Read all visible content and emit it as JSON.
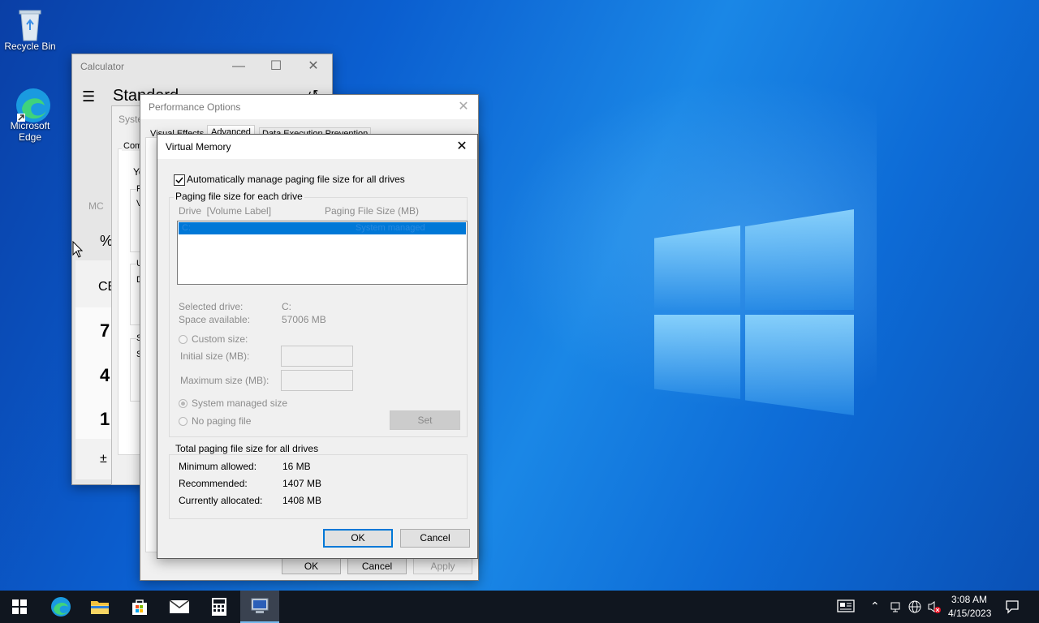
{
  "desktop": {
    "icons": [
      {
        "label": "Recycle Bin",
        "icon": "recycle-bin-icon"
      },
      {
        "label": "Microsoft Edge",
        "icon": "edge-icon"
      }
    ]
  },
  "calculator": {
    "title": "Calculator",
    "mode": "Standard",
    "buttons": [
      "MC",
      "%",
      "CE",
      "7",
      "4",
      "1",
      "±"
    ]
  },
  "system_properties": {
    "title_partial": "Syste",
    "tab_partial": "Com",
    "text_fragments": [
      "Yo",
      "P",
      "V",
      "U",
      "D",
      "S",
      "S"
    ]
  },
  "performance_options": {
    "title": "Performance Options",
    "tabs": [
      "Visual Effects",
      "Advanced",
      "Data Execution Prevention"
    ],
    "active_tab": "Advanced",
    "buttons": {
      "ok": "OK",
      "cancel": "Cancel",
      "apply": "Apply"
    }
  },
  "virtual_memory": {
    "title": "Virtual Memory",
    "auto_manage_label": "Automatically manage paging file size for all drives",
    "auto_manage_checked": true,
    "per_drive_group": "Paging file size for each drive",
    "columns": {
      "drive": "Drive  [Volume Label]",
      "size": "Paging File Size (MB)"
    },
    "rows": [
      {
        "drive": "C:",
        "size": "System managed"
      }
    ],
    "selected_drive_label": "Selected drive:",
    "selected_drive_value": "C:",
    "space_available_label": "Space available:",
    "space_available_value": "57006 MB",
    "custom_size_label": "Custom size:",
    "initial_size_label": "Initial size (MB):",
    "maximum_size_label": "Maximum size (MB):",
    "system_managed_label": "System managed size",
    "no_paging_label": "No paging file",
    "set_button": "Set",
    "total_group": "Total paging file size for all drives",
    "minimum_allowed_label": "Minimum allowed:",
    "minimum_allowed_value": "16 MB",
    "recommended_label": "Recommended:",
    "recommended_value": "1407 MB",
    "currently_allocated_label": "Currently allocated:",
    "currently_allocated_value": "1408 MB",
    "ok_button": "OK",
    "cancel_button": "Cancel"
  },
  "taskbar": {
    "items": [
      "start-icon",
      "edge-icon",
      "file-explorer-icon",
      "store-icon",
      "mail-icon",
      "calculator-icon",
      "system-properties-icon"
    ],
    "time": "3:08 AM",
    "date": "4/15/2023"
  },
  "colors": {
    "accent": "#0078d7",
    "selection": "#0078d7",
    "taskbar": "#10161f"
  }
}
